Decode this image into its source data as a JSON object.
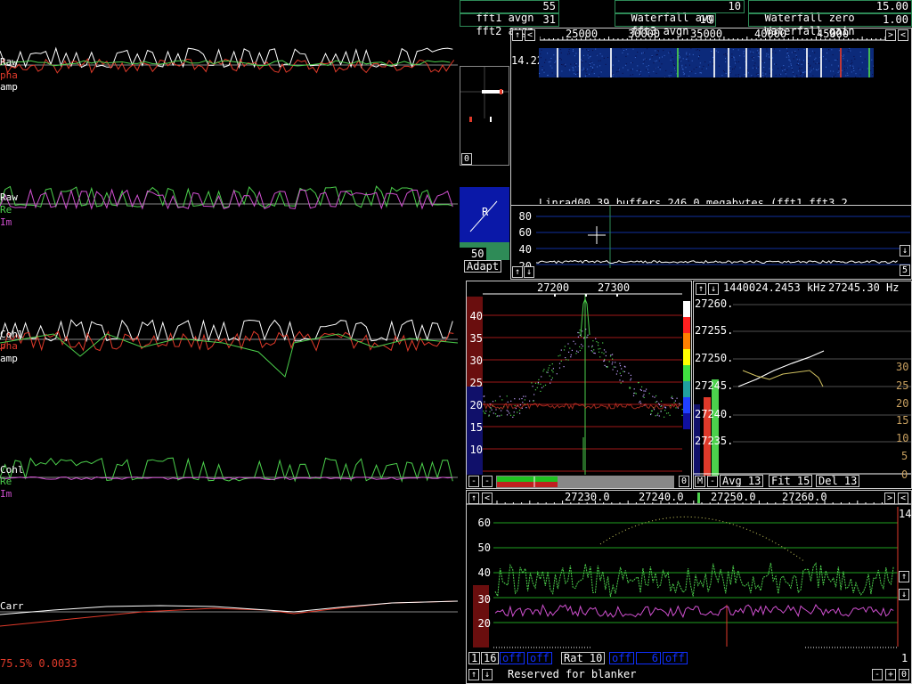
{
  "colors": {
    "green": "#4cd14c",
    "red": "#e03a2a",
    "white": "#ffffff",
    "magenta": "#d050d0",
    "blue": "#1030ff",
    "olive": "#c8a060",
    "dark_red": "#6a0e0e",
    "dark_blue": "#10106a"
  },
  "status": {
    "fft1_avgn_label": "fft1 avgn",
    "fft1_avgn_value": "55",
    "fft2_avgn_label": "fft2 avgn",
    "fft2_avgn_value": "31",
    "waterfall_avg_label": "Waterfall avg",
    "waterfall_avg_value": "10",
    "fft3_avgn_label": "fft3 avgn",
    "fft3_avgn_value": "10",
    "waterfall_zero_label": "Waterfall zero",
    "waterfall_zero_value": "15.00",
    "waterfall_gain_label": "Waterfall gain",
    "waterfall_gain_value": "1.00"
  },
  "left_panels": {
    "p1_raw": "Raw",
    "p1_pha": "pha",
    "p1_amp": "amp",
    "p2_raw": "Raw",
    "p2_re": "Re",
    "p2_im": "Im",
    "p3_cohi": "Cohl",
    "p3_pha": "pha",
    "p3_amp": "amp",
    "p4_cohi": "Cohl",
    "p4_re": "Re",
    "p4_im": "Im",
    "p5_carr": "Carr",
    "bottom_readout": "75.5% 0.0033"
  },
  "waterfall": {
    "x_ticks": [
      "25000",
      "30000",
      "35000",
      "40000",
      "45000"
    ],
    "time_label": "14.22",
    "info_text": "Linrad00 39 buffers 246.0 megabytes  (fft1 fft3 2",
    "y_ticks": [
      "80",
      "60",
      "40",
      "20"
    ],
    "right_button": "5",
    "arrow_left": "<",
    "arrow_right": ">",
    "arrow_up": "↑",
    "arrow_down": "↓"
  },
  "polar": {
    "zero_button": "0",
    "letter": "R",
    "value": "50",
    "adapt_button": "Adapt"
  },
  "spectrum": {
    "x_ticks": [
      "27200",
      "27300"
    ],
    "y_ticks": [
      "40",
      "35",
      "30",
      "25",
      "20",
      "15",
      "10"
    ],
    "minus1": "-",
    "minus2": "-",
    "zero_button": "0"
  },
  "freq_panel": {
    "up": "↑",
    "down": "↓",
    "freq_readout": "1440024.2453 kHz",
    "hz_readout": "27245.30 Hz",
    "y_ticks": [
      "27260.",
      "27255.",
      "27250.",
      "27245.",
      "27240.",
      "27235."
    ],
    "y_ticks_right": [
      "30",
      "25",
      "20",
      "15",
      "10",
      "5",
      "0"
    ],
    "m_button": "M",
    "minus_button": "-",
    "avg_button": "Avg 13",
    "fit_button": "Fit 15",
    "del_button": "Del 13"
  },
  "baseband": {
    "x_ticks": [
      "27230.0",
      "27240.0",
      "27250.0",
      "27260.0"
    ],
    "y_ticks": [
      "60",
      "50",
      "40",
      "30",
      "20"
    ],
    "right_value": "14",
    "b1": "1",
    "b16": "16",
    "off1": "off",
    "off2": "off",
    "rat": "Rat 10",
    "off3": "off",
    "off6": "6",
    "off4": "off",
    "right_one": "1",
    "blanker_text": "Reserved for blanker",
    "minus": "-",
    "plus": "+",
    "zero": "0"
  }
}
